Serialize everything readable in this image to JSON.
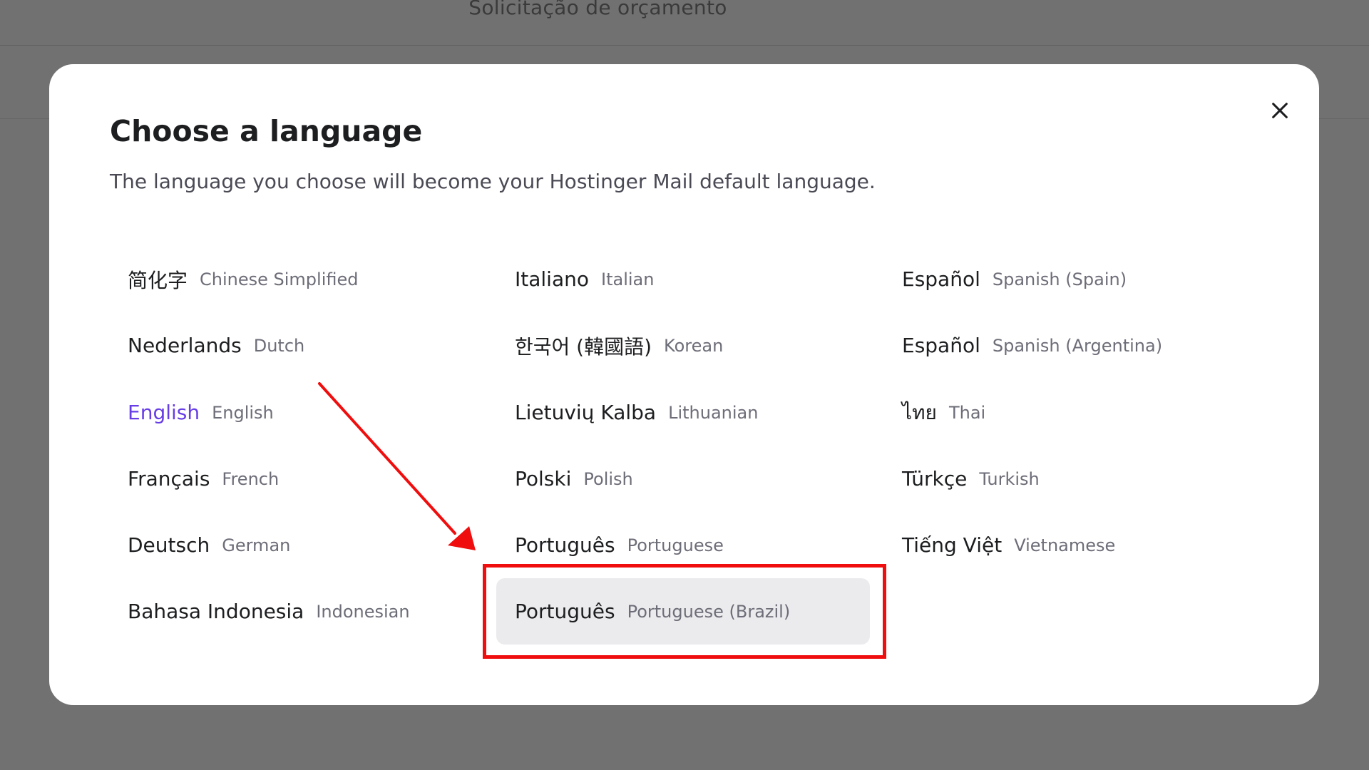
{
  "background": {
    "page_title": "Solicitação de orçamento"
  },
  "dialog": {
    "title": "Choose a language",
    "subtitle": "The language you choose will become your Hostinger Mail default language.",
    "close_icon": "close-icon",
    "current_language": "English",
    "selected_language": "Português (Portuguese (Brazil))",
    "languages": [
      {
        "native": "简化字",
        "english": "Chinese Simplified"
      },
      {
        "native": "Nederlands",
        "english": "Dutch"
      },
      {
        "native": "English",
        "english": "English"
      },
      {
        "native": "Français",
        "english": "French"
      },
      {
        "native": "Deutsch",
        "english": "German"
      },
      {
        "native": "Bahasa Indonesia",
        "english": "Indonesian"
      },
      {
        "native": "Italiano",
        "english": "Italian"
      },
      {
        "native": "한국어 (韓國語)",
        "english": "Korean"
      },
      {
        "native": "Lietuvių Kalba",
        "english": "Lithuanian"
      },
      {
        "native": "Polski",
        "english": "Polish"
      },
      {
        "native": "Português",
        "english": "Portuguese"
      },
      {
        "native": "Português",
        "english": "Portuguese (Brazil)"
      },
      {
        "native": "Español",
        "english": "Spanish (Spain)"
      },
      {
        "native": "Español",
        "english": "Spanish (Argentina)"
      },
      {
        "native": "ไทย",
        "english": "Thai"
      },
      {
        "native": "Türkçe",
        "english": "Turkish"
      },
      {
        "native": "Tiếng Việt",
        "english": "Vietnamese"
      }
    ]
  },
  "colors": {
    "accent_current": "#673de6",
    "selected_background": "#ebebed",
    "annotation_red": "#f00d0d",
    "overlay": "#717171"
  }
}
